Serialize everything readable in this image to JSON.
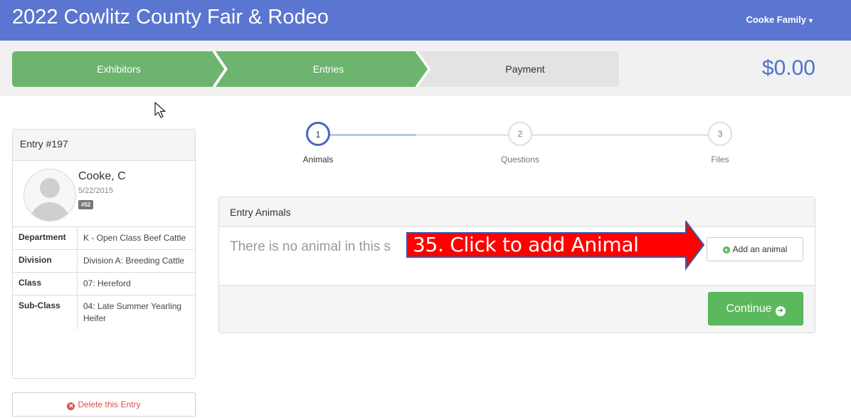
{
  "header": {
    "title": "2022 Cowlitz County Fair & Rodeo",
    "user_menu": "Cooke Family",
    "colors": {
      "bar": "#5b76d0"
    }
  },
  "wizard": {
    "steps": [
      {
        "label": "Exhibitors",
        "state": "complete"
      },
      {
        "label": "Entries",
        "state": "active"
      },
      {
        "label": "Payment",
        "state": "pending"
      }
    ],
    "total": "$0.00",
    "colors": {
      "done": "#6db46f",
      "pending": "#e3e3e3"
    }
  },
  "entry": {
    "title": "Entry #197",
    "name": "Cooke, C",
    "date": "5/22/2015",
    "badge": "#52",
    "fields": [
      {
        "key": "Department",
        "value": "K - Open Class Beef Cattle"
      },
      {
        "key": "Division",
        "value": "Division A: Breeding Cattle"
      },
      {
        "key": "Class",
        "value": "07: Hereford"
      },
      {
        "key": "Sub-Class",
        "value": "04: Late Summer Yearling Heifer"
      }
    ],
    "delete_label": "Delete this Entry"
  },
  "steps": {
    "items": [
      {
        "number": "1",
        "label": "Animals",
        "state": "active"
      },
      {
        "number": "2",
        "label": "Questions",
        "state": "pending"
      },
      {
        "number": "3",
        "label": "Files",
        "state": "pending"
      }
    ]
  },
  "animals": {
    "title": "Entry Animals",
    "empty_message": "There is no animal in this s",
    "add_label": "Add an animal",
    "continue_label": "Continue"
  },
  "annotation": {
    "text": "35. Click to add Animal",
    "color": "#ff0000"
  }
}
